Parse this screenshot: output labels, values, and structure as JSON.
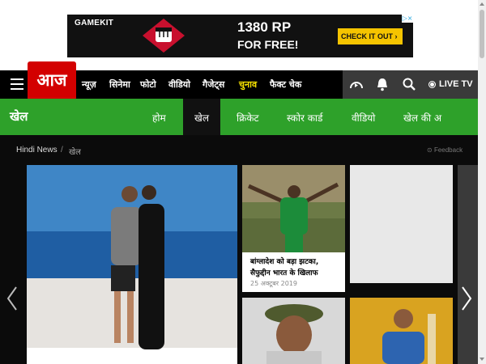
{
  "ad": {
    "brand": "GAMEKIT",
    "line1": "1380 RP",
    "line2": "FOR FREE!",
    "cta": "CHECK IT OUT ›",
    "adchoices_icon": "adchoices-icon"
  },
  "logo": {
    "text": "आज तक"
  },
  "nav": {
    "items": [
      "न्यूज़",
      "सिनेमा",
      "फोटो",
      "वीडियो",
      "गैजेट्स",
      "चुनाव",
      "फैक्ट चेक"
    ],
    "highlight_index": 5,
    "highlight_color": "#f5e000",
    "live_tv": "LIVE TV"
  },
  "section": {
    "title": "खेल",
    "tabs": [
      "होम",
      "खेल",
      "क्रिकेट",
      "स्कोर कार्ड",
      "वीडियो",
      "खेल की अ"
    ],
    "active_index": 1,
    "color": "#2ea12a"
  },
  "breadcrumb": {
    "home": "Hindi News",
    "sep": "/",
    "current": "खेल"
  },
  "feedback": "Feedback",
  "cards": [
    {
      "caption": "बांग्लादेश को बड़ा झटका, सैफुद्दीन भारत के खिलाफ",
      "date": "25 अक्टूबर 2019"
    }
  ]
}
